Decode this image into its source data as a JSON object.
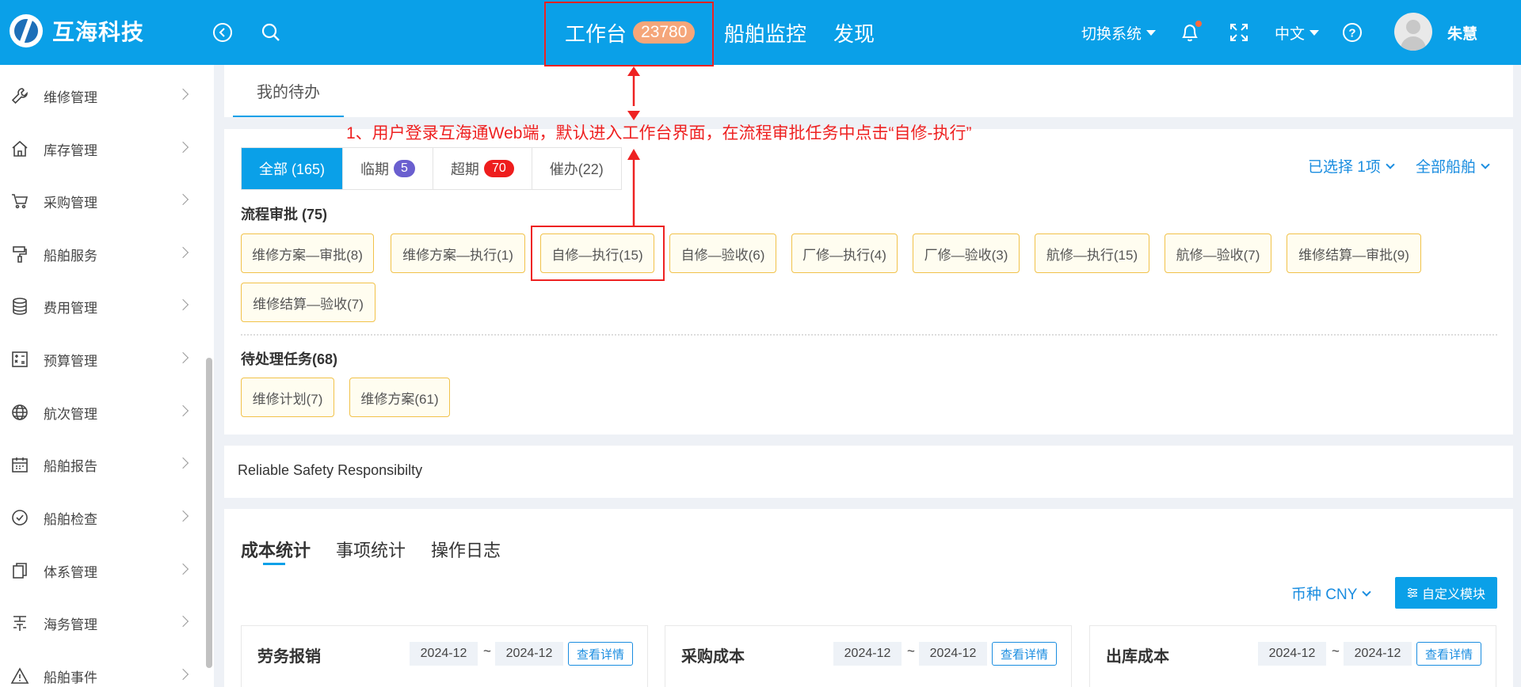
{
  "header": {
    "brand": "互海科技",
    "nav": [
      {
        "label": "工作台",
        "badge": "23780"
      },
      {
        "label": "船舶监控"
      },
      {
        "label": "发现"
      }
    ],
    "switch_system": "切换系统",
    "language": "中文",
    "user_name": "朱慧",
    "accent_color": "#0aa0e8"
  },
  "sidebar": {
    "items": [
      {
        "label": "维修管理",
        "icon": "wrench-icon"
      },
      {
        "label": "库存管理",
        "icon": "home-icon"
      },
      {
        "label": "采购管理",
        "icon": "cart-icon"
      },
      {
        "label": "船舶服务",
        "icon": "paint-roller-icon"
      },
      {
        "label": "费用管理",
        "icon": "database-icon"
      },
      {
        "label": "预算管理",
        "icon": "calculator-icon"
      },
      {
        "label": "航次管理",
        "icon": "globe-icon"
      },
      {
        "label": "船舶报告",
        "icon": "calendar-icon"
      },
      {
        "label": "船舶检查",
        "icon": "check-circle-icon"
      },
      {
        "label": "体系管理",
        "icon": "documents-icon"
      },
      {
        "label": "海务管理",
        "icon": "anchor-icon"
      },
      {
        "label": "船舶事件",
        "icon": "warning-icon"
      }
    ]
  },
  "todo": {
    "tab_label": "我的待办",
    "filters": [
      {
        "label": "全部 (165)"
      },
      {
        "label": "临期",
        "count": "5"
      },
      {
        "label": "超期",
        "count": "70"
      },
      {
        "label": "催办(22)"
      }
    ],
    "selected_label": "已选择 1项",
    "ship_filter": "全部船舶",
    "approval_title": "流程审批 (75)",
    "approval_chips": [
      "维修方案—审批(8)",
      "维修方案—执行(1)",
      "自修—执行(15)",
      "自修—验收(6)",
      "厂修—执行(4)",
      "厂修—验收(3)",
      "航修—执行(15)",
      "航修—验收(7)",
      "维修结算—审批(9)",
      "维修结算—验收(7)"
    ],
    "pending_title": "待处理任务(68)",
    "pending_chips": [
      "维修计划(7)",
      "维修方案(61)"
    ]
  },
  "annotation": {
    "text": "1、用户登录互海通Web端，默认进入工作台界面，在流程审批任务中点击“自修-执行”",
    "color": "#ee2222"
  },
  "motto": "Reliable Safety Responsibilty",
  "stats": {
    "tabs": [
      "成本统计",
      "事项统计",
      "操作日志"
    ],
    "currency": "币种 CNY",
    "custom_button": "自定义模块",
    "cards": [
      {
        "title": "劳务报销",
        "from": "2024-12",
        "to": "2024-12",
        "detail": "查看详情"
      },
      {
        "title": "采购成本",
        "from": "2024-12",
        "to": "2024-12",
        "detail": "查看详情"
      },
      {
        "title": "出库成本",
        "from": "2024-12",
        "to": "2024-12",
        "detail": "查看详情"
      }
    ],
    "tilde": "~"
  }
}
